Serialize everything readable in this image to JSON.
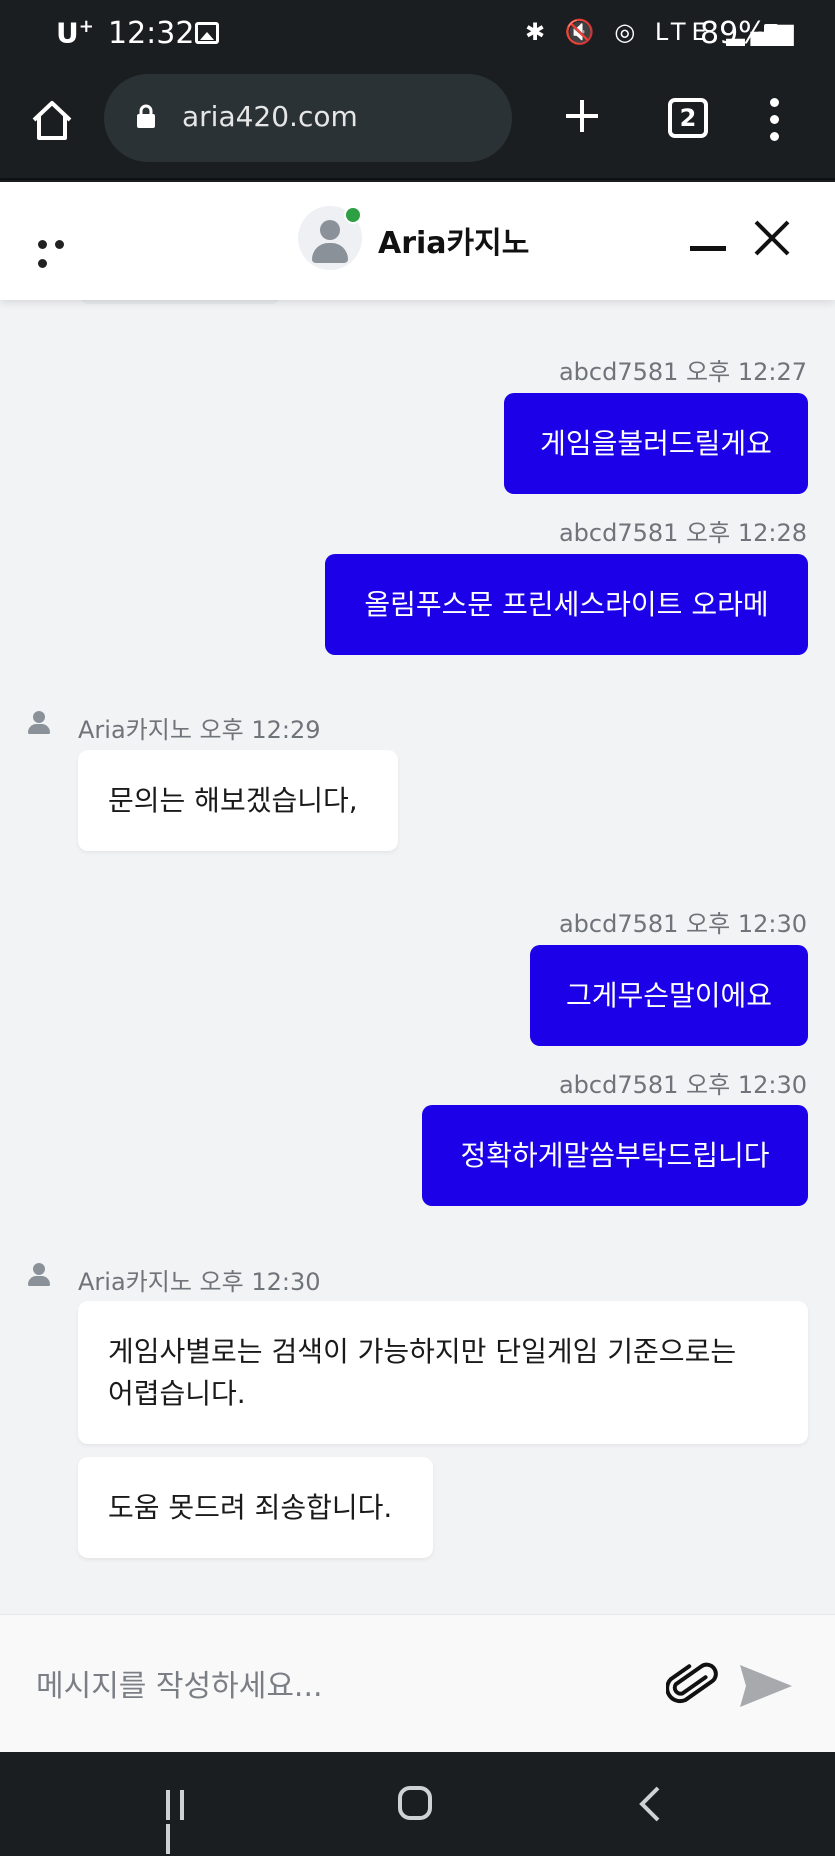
{
  "status_bar": {
    "carrier": "U",
    "carrier_sup": "+",
    "time": "12:32",
    "icons": "✱ 🔇 ◎ LTE ▂▄▆",
    "battery": "89%"
  },
  "browser": {
    "url": "aria420.com",
    "tab_count": "2"
  },
  "chat_header": {
    "title": "Aria카지노",
    "online_color": "#2ea043"
  },
  "messages": [
    {
      "meta": "abcd7581 오후 12:27",
      "text": "게임을불러드릴게요"
    },
    {
      "meta": "abcd7581 오후 12:28",
      "text": "올림푸스문 프린세스라이트 오라메"
    },
    {
      "meta": "Aria카지노 오후 12:29",
      "text": "문의는 해보겠습니다,"
    },
    {
      "meta": "abcd7581 오후 12:30",
      "text": "그게무슨말이에요"
    },
    {
      "meta": "abcd7581 오후 12:30",
      "text": "정확하게말씀부탁드립니다"
    },
    {
      "meta": "Aria카지노 오후 12:30",
      "text": "게임사별로는 검색이 가능하지만 단일게임 기준으로는 어렵습니다."
    },
    {
      "meta": "",
      "text": "도움 못드려 죄송합니다."
    }
  ],
  "composer": {
    "placeholder": "메시지를 작성하세요..."
  },
  "colors": {
    "outgoing_bubble": "#1b00e8",
    "incoming_bubble": "#ffffff",
    "chat_background": "#f2f3f5"
  }
}
